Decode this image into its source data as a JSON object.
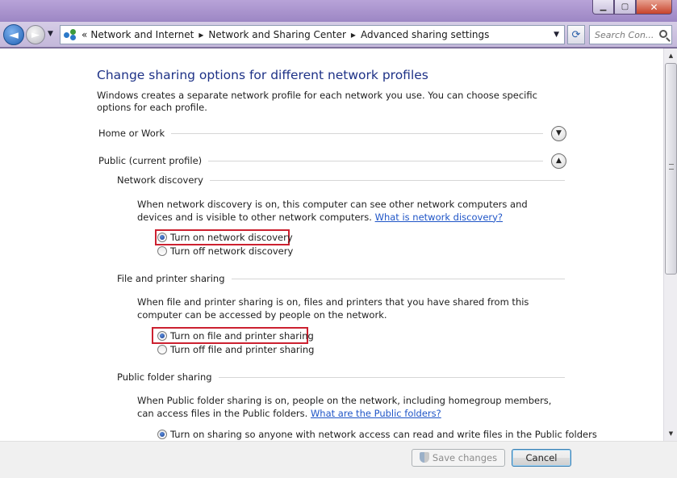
{
  "window": {
    "controls": {
      "minimize": "▁",
      "maximize": "▢",
      "close": "✕"
    }
  },
  "nav": {
    "back_glyph": "◄",
    "forward_glyph": "►",
    "overflow": "«",
    "breadcrumb": [
      "Network and Internet",
      "Network and Sharing Center",
      "Advanced sharing settings"
    ],
    "search_placeholder": "Search Con..."
  },
  "content": {
    "title": "Change sharing options for different network profiles",
    "intro": "Windows creates a separate network profile for each network you use. You can choose specific options for each profile.",
    "profiles": {
      "home_or_work": {
        "label": "Home or Work",
        "state": "collapsed"
      },
      "public": {
        "label": "Public (current profile)",
        "state": "expanded"
      }
    },
    "sections": {
      "network_discovery": {
        "heading": "Network discovery",
        "description": "When network discovery is on, this computer can see other network computers and devices and is visible to other network computers.",
        "link": "What is network discovery?",
        "options": [
          "Turn on network discovery",
          "Turn off network discovery"
        ],
        "selected": 0
      },
      "file_printer_sharing": {
        "heading": "File and printer sharing",
        "description": "When file and printer sharing is on, files and printers that you have shared from this computer can be accessed by people on the network.",
        "options": [
          "Turn on file and printer sharing",
          "Turn off file and printer sharing"
        ],
        "selected": 0
      },
      "public_folder_sharing": {
        "heading": "Public folder sharing",
        "description": "When Public folder sharing is on, people on the network, including homegroup members, can access files in the Public folders.",
        "link": "What are the Public folders?",
        "options": [
          "Turn on sharing so anyone with network access can read and write files in the Public folders"
        ],
        "selected": 0
      }
    }
  },
  "footer": {
    "save_label": "Save changes",
    "cancel_label": "Cancel"
  },
  "colors": {
    "title_blue": "#1e3287",
    "link_blue": "#1f55c7",
    "highlight_red": "#cc2130"
  }
}
